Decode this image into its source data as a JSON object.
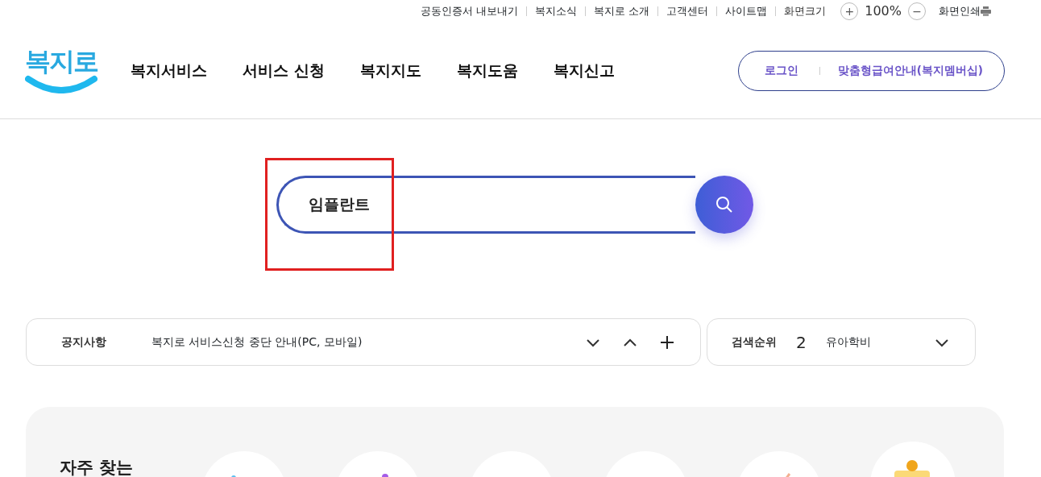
{
  "utility_links": [
    "공동인증서 내보내기",
    "복지소식",
    "복지로 소개",
    "고객센터",
    "사이트맵"
  ],
  "zoom": {
    "label": "화면크기",
    "plus": "+",
    "value": "100%",
    "minus": "−"
  },
  "print": {
    "label": "화면인쇄"
  },
  "logo": {
    "text": "복지로"
  },
  "nav": [
    "복지서비스",
    "서비스 신청",
    "복지지도",
    "복지도움",
    "복지신고"
  ],
  "account": {
    "login": "로그인",
    "membership": "맞춤형급여안내(복지멤버십)"
  },
  "search": {
    "value": "임플란트"
  },
  "notice": {
    "label": "공지사항",
    "text": "복지로 서비스신청 중단 안내(PC, 모바일)"
  },
  "ranking": {
    "label": "검색순위",
    "rank": "2",
    "term": "유아학비"
  },
  "frequent": {
    "title": "자주 찾는"
  }
}
